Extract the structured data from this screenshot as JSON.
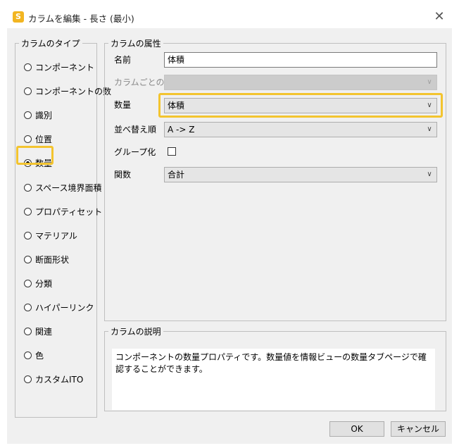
{
  "window": {
    "title": "カラムを編集 - 長さ (最小)",
    "app_icon_letter": "S",
    "close_glyph": "✕"
  },
  "column_type": {
    "legend": "カラムのタイプ",
    "selected": "数量",
    "options": [
      "コンポーネント",
      "コンポーネントの数",
      "識別",
      "位置",
      "数量",
      "スペース境界面積",
      "プロパティセット",
      "マテリアル",
      "断面形状",
      "分類",
      "ハイパーリンク",
      "関連",
      "色",
      "カスタムITO"
    ]
  },
  "attributes": {
    "legend": "カラムの属性",
    "name_label": "名前",
    "name_value": "体積",
    "per_value_label": "カラムごとの値",
    "per_value_value": "",
    "quantity_label": "数量",
    "quantity_value": "体積",
    "sort_label": "並べ替え順",
    "sort_value": "A -> Z",
    "group_label": "グループ化",
    "group_checked": false,
    "function_label": "関数",
    "function_value": "合計"
  },
  "description": {
    "legend": "カラムの説明",
    "text": "コンポーネントの数量プロパティです。数量値を情報ビューの数量タブページで確認することができます。"
  },
  "buttons": {
    "ok": "OK",
    "cancel": "キャンセル"
  },
  "colors": {
    "highlight": "#f3c42f",
    "dialog_bg": "#f0f0f0"
  }
}
